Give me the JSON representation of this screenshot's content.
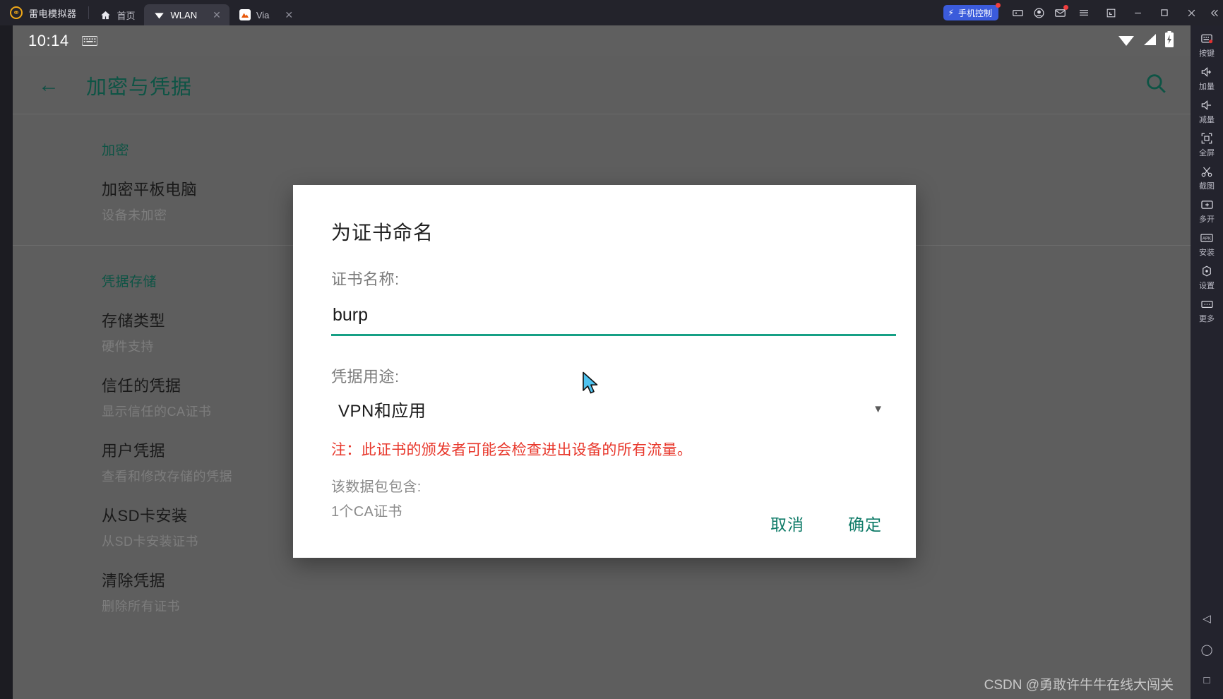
{
  "window": {
    "brand": "雷电模拟器",
    "brand_logo_icon": "ld-player-logo-icon",
    "tabs": [
      {
        "label": "首页",
        "icon": "home-icon",
        "active": false,
        "closable": false
      },
      {
        "label": "WLAN",
        "icon": "wifi-icon",
        "active": true,
        "closable": true
      },
      {
        "label": "Via",
        "icon": "via-browser-icon",
        "active": false,
        "closable": true
      }
    ],
    "phone_control_label": "手机控制",
    "phone_control_icon": "bolt-icon",
    "tray_icons": [
      "gamepad-icon",
      "account-icon",
      "mail-icon"
    ],
    "controls": [
      "hamburger-menu-icon",
      "restore-down-icon",
      "minimize-icon",
      "maximize-icon",
      "close-icon",
      "collapse-sidebar-icon"
    ],
    "accent_blue": "#3b5bdb",
    "badge_red": "#f03e3e"
  },
  "status_bar": {
    "time": "10:14",
    "keyboard_icon": "keyboard-icon",
    "right_icons": [
      "wifi-icon",
      "signal-icon",
      "battery-charging-icon"
    ]
  },
  "app_bar": {
    "back_icon": "back-arrow-icon",
    "title": "加密与凭据",
    "search_icon": "search-icon",
    "accent_green": "#11604f"
  },
  "settings": {
    "sections": [
      {
        "header": "加密",
        "items": [
          {
            "title": "加密平板电脑",
            "subtitle": "设备未加密"
          }
        ]
      },
      {
        "header": "凭据存储",
        "items": [
          {
            "title": "存储类型",
            "subtitle": "硬件支持"
          },
          {
            "title": "信任的凭据",
            "subtitle": "显示信任的CA证书"
          },
          {
            "title": "用户凭据",
            "subtitle": "查看和修改存储的凭据"
          },
          {
            "title": "从SD卡安装",
            "subtitle": "从SD卡安装证书"
          },
          {
            "title": "清除凭据",
            "subtitle": "删除所有证书"
          }
        ]
      }
    ]
  },
  "dialog": {
    "title": "为证书命名",
    "name_label": "证书名称:",
    "name_value": "burp",
    "name_placeholder": "",
    "usage_label": "凭据用途:",
    "usage_value": "VPN和应用",
    "usage_caret_icon": "chevron-down-icon",
    "warning": "注：此证书的颁发者可能会检查进出设备的所有流量。",
    "contains_label": "该数据包包含:",
    "contains_value": "1个CA证书",
    "cancel_label": "取消",
    "confirm_label": "确定",
    "accent_teal": "#16a085",
    "warning_red": "#e8372b",
    "action_green": "#0f7b68"
  },
  "sidebar": {
    "items": [
      {
        "label": "按键",
        "icon": "keymapping-icon"
      },
      {
        "label": "加量",
        "icon": "volume-up-icon"
      },
      {
        "label": "减量",
        "icon": "volume-down-icon"
      },
      {
        "label": "全屏",
        "icon": "fullscreen-icon"
      },
      {
        "label": "截图",
        "icon": "screenshot-scissors-icon"
      },
      {
        "label": "多开",
        "icon": "multi-instance-icon"
      },
      {
        "label": "安装",
        "icon": "install-apk-icon"
      },
      {
        "label": "设置",
        "icon": "settings-gear-icon"
      },
      {
        "label": "更多",
        "icon": "more-dots-icon"
      }
    ],
    "nav": [
      {
        "icon": "android-back-icon"
      },
      {
        "icon": "android-home-icon"
      },
      {
        "icon": "android-recents-icon"
      }
    ]
  },
  "watermark": "CSDN @勇敢许牛牛在线大闯关"
}
